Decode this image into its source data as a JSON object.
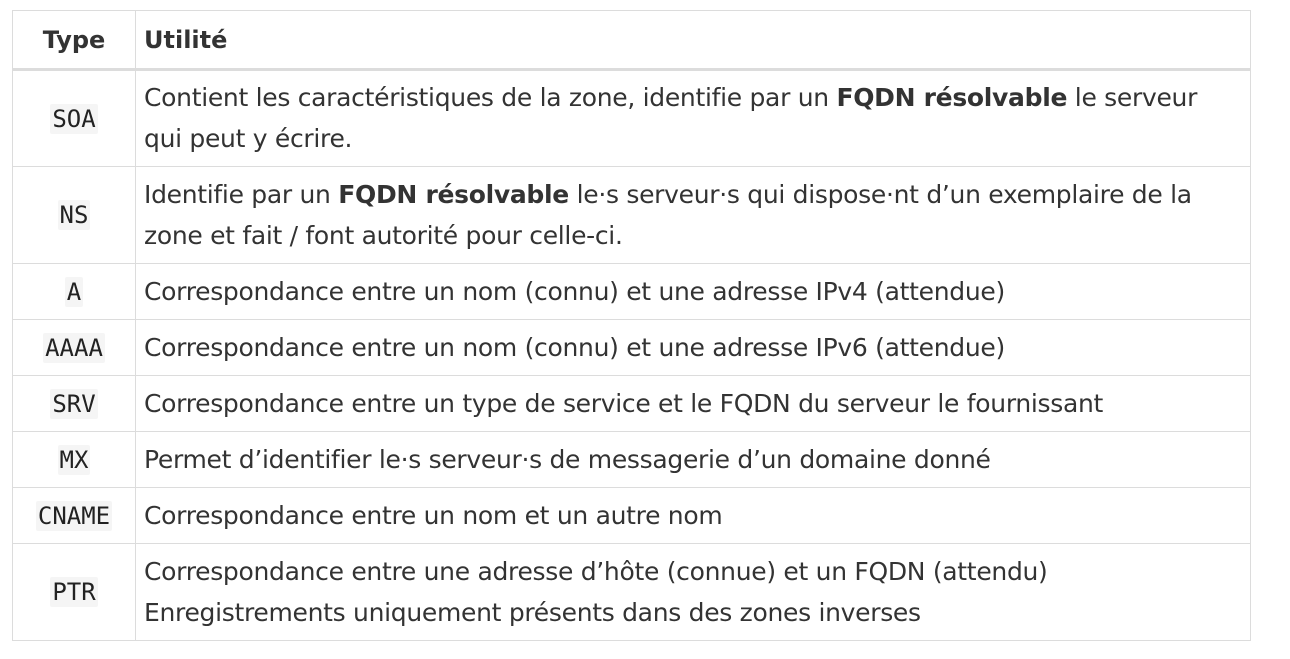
{
  "table": {
    "headers": {
      "type": "Type",
      "utility": "Utilité"
    },
    "rows": [
      {
        "type": "SOA",
        "text_before": "Contient les caractéristiques de la zone, identifie par un ",
        "bold": "FQDN résolvable",
        "text_after": " le serveur qui peut y écrire."
      },
      {
        "type": "NS",
        "text_before": "Identifie par un ",
        "bold": "FQDN résolvable",
        "text_after": " le·s serveur·s qui dispose·nt d’un exemplaire de la zone et fait / font autorité pour celle-ci."
      },
      {
        "type": "A",
        "text": "Correspondance entre un nom (connu) et une adresse IPv4 (attendue)"
      },
      {
        "type": "AAAA",
        "text": "Correspondance entre un nom (connu) et une adresse IPv6 (attendue)"
      },
      {
        "type": "SRV",
        "text": "Correspondance entre un type de service et le FQDN du serveur le fournissant"
      },
      {
        "type": "MX",
        "text": "Permet d’identifier le·s serveur·s de messagerie d’un domaine donné"
      },
      {
        "type": "CNAME",
        "text": "Correspondance entre un nom et un autre nom"
      },
      {
        "type": "PTR",
        "line1": "Correspondance entre une adresse d’hôte (connue) et un FQDN (attendu)",
        "line2": "Enregistrements uniquement présents dans des zones inverses"
      }
    ]
  }
}
